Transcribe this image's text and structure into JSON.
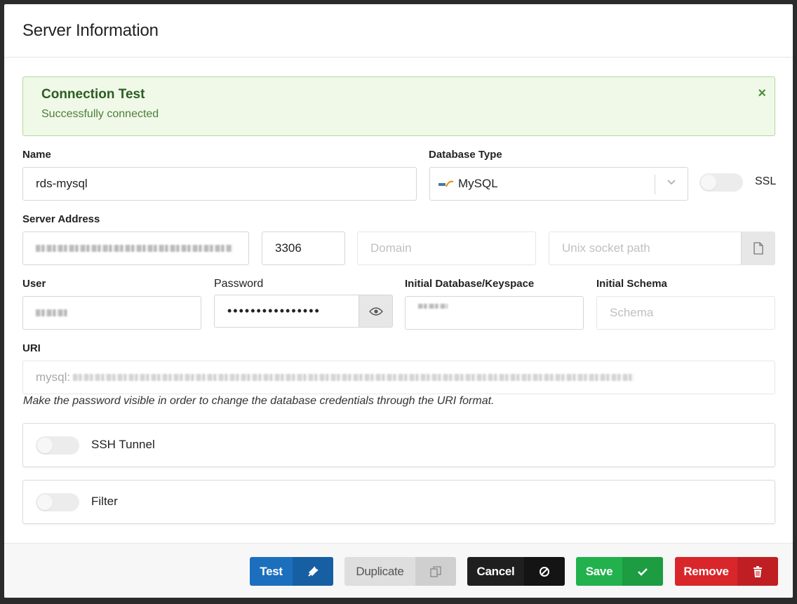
{
  "dialog": {
    "title": "Server Information"
  },
  "alert": {
    "title": "Connection Test",
    "message": "Successfully connected",
    "close": "×"
  },
  "fields": {
    "name": {
      "label": "Name",
      "value": "rds-mysql"
    },
    "database_type": {
      "label": "Database Type",
      "value": "MySQL"
    },
    "ssl": {
      "label": "SSL",
      "enabled": false
    },
    "server_address": {
      "label": "Server Address"
    },
    "port": {
      "value": "3306"
    },
    "domain": {
      "placeholder": "Domain"
    },
    "unix_socket": {
      "placeholder": "Unix socket path"
    },
    "user": {
      "label": "User"
    },
    "password": {
      "label": "Password",
      "value": "••••••••••••••••"
    },
    "initial_database": {
      "label": "Initial Database/Keyspace"
    },
    "initial_schema": {
      "label": "Initial Schema",
      "placeholder": "Schema"
    },
    "uri": {
      "label": "URI",
      "prefix": "mysql:",
      "hint": "Make the password visible in order to change the database credentials through the URI format."
    }
  },
  "panels": {
    "ssh_tunnel": {
      "label": "SSH Tunnel",
      "enabled": false
    },
    "filter": {
      "label": "Filter",
      "enabled": false
    }
  },
  "footer": {
    "test_label": "Test",
    "duplicate_label": "Duplicate",
    "cancel_label": "Cancel",
    "save_label": "Save",
    "remove_label": "Remove"
  },
  "colors": {
    "test": "#1b6fbd",
    "duplicate": "#dedede",
    "cancel": "#1f1f1f",
    "save": "#22b14c",
    "remove": "#d9262a",
    "alert_bg": "#f0f9e8"
  }
}
